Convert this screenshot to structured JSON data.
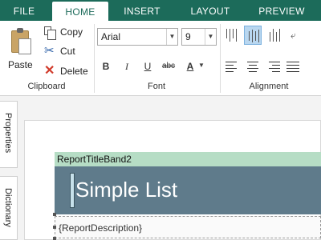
{
  "tabs": [
    "FILE",
    "HOME",
    "INSERT",
    "LAYOUT",
    "PREVIEW"
  ],
  "active_tab": "HOME",
  "clipboard": {
    "paste": "Paste",
    "copy": "Copy",
    "cut": "Cut",
    "delete": "Delete",
    "group": "Clipboard"
  },
  "font": {
    "family": "Arial",
    "size": "9",
    "group": "Font",
    "bold": "B",
    "italic": "I",
    "underline": "U",
    "strike": "abc",
    "color": "A"
  },
  "alignment": {
    "group": "Alignment"
  },
  "side_tabs": {
    "properties": "Properties",
    "dictionary": "Dictionary"
  },
  "report": {
    "band_title": "ReportTitleBand2",
    "title": "Simple List",
    "description": "{ReportDescription}"
  },
  "colors": {
    "tabbar": "#1c6b5a",
    "band": "#b6ddc5",
    "title_bg": "#5f7b8b"
  }
}
